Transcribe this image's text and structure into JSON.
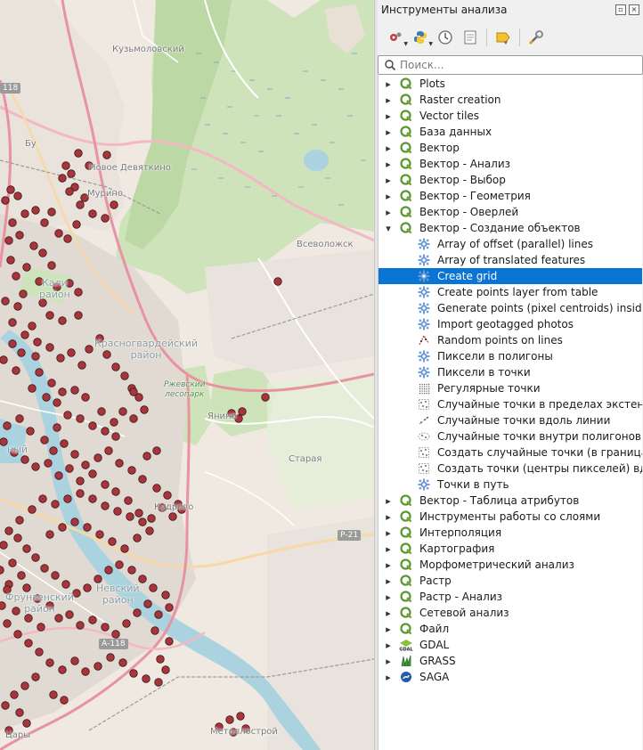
{
  "panel": {
    "title": "Инструменты анализа",
    "search_placeholder": "Поиск...",
    "toolbar": [
      "models-icon",
      "python-icon",
      "history-icon",
      "results-icon",
      "edit-features-icon",
      "options-icon"
    ]
  },
  "map": {
    "labels": {
      "kuzmolovsky": "Кузьмоловский",
      "novoe_devyatkino": "Новое Девяткино",
      "murino": "Мурино",
      "vsevolozhsk": "Всеволожск",
      "kalininsky_1": "Кали",
      "kalininsky_2": "район",
      "krasnogvardeisky_1": "Красногвардейский",
      "krasnogvardeisky_2": "район",
      "rzhevsky_1": "Ржевский",
      "rzhevsky_2": "лесопарк",
      "yanino": "Янино",
      "staraya": "Старая",
      "kudrovo": "Кудрово",
      "nevsky_1": "Невский",
      "nevsky_2": "район",
      "frunzensky_1": "Фрунзенский",
      "frunzensky_2": "район",
      "metallostroy": "Металлострой",
      "a118_top": "118",
      "a118_bottom": "А-118",
      "r21": "Р-21",
      "bu": "Бу",
      "ny": "ный",
      "tsary": "Цары"
    }
  },
  "tree": [
    {
      "label": "Plots",
      "level": 0,
      "icon": "qgis-icon",
      "expanded": false
    },
    {
      "label": "Raster creation",
      "level": 0,
      "icon": "qgis-icon",
      "expanded": false
    },
    {
      "label": "Vector tiles",
      "level": 0,
      "icon": "qgis-icon",
      "expanded": false
    },
    {
      "label": "База данных",
      "level": 0,
      "icon": "qgis-icon",
      "expanded": false
    },
    {
      "label": "Вектор",
      "level": 0,
      "icon": "qgis-icon",
      "expanded": false
    },
    {
      "label": "Вектор - Анализ",
      "level": 0,
      "icon": "qgis-icon",
      "expanded": false
    },
    {
      "label": "Вектор - Выбор",
      "level": 0,
      "icon": "qgis-icon",
      "expanded": false
    },
    {
      "label": "Вектор - Геометрия",
      "level": 0,
      "icon": "qgis-icon",
      "expanded": false
    },
    {
      "label": "Вектор - Оверлей",
      "level": 0,
      "icon": "qgis-icon",
      "expanded": false
    },
    {
      "label": "Вектор - Создание объектов",
      "level": 0,
      "icon": "qgis-icon",
      "expanded": true
    },
    {
      "label": "Array of offset (parallel) lines",
      "level": 1,
      "icon": "gear-icon"
    },
    {
      "label": "Array of translated features",
      "level": 1,
      "icon": "gear-icon"
    },
    {
      "label": "Create grid",
      "level": 1,
      "icon": "gear-icon",
      "selected": true
    },
    {
      "label": "Create points layer from table",
      "level": 1,
      "icon": "gear-icon"
    },
    {
      "label": "Generate points (pixel centroids) inside p...",
      "level": 1,
      "icon": "gear-icon"
    },
    {
      "label": "Import geotagged photos",
      "level": 1,
      "icon": "gear-icon"
    },
    {
      "label": "Random points on lines",
      "level": 1,
      "icon": "random-points-lines-icon"
    },
    {
      "label": "Пиксели в полигоны",
      "level": 1,
      "icon": "gear-icon"
    },
    {
      "label": "Пиксели в точки",
      "level": 1,
      "icon": "gear-icon"
    },
    {
      "label": "Регулярные точки",
      "level": 1,
      "icon": "regular-points-icon"
    },
    {
      "label": "Случайные точки в пределах экстента",
      "level": 1,
      "icon": "random-points-extent-icon"
    },
    {
      "label": "Случайные точки вдоль линии",
      "level": 1,
      "icon": "random-points-line-icon"
    },
    {
      "label": "Случайные точки внутри полигонов",
      "level": 1,
      "icon": "random-points-polygon-icon"
    },
    {
      "label": "Создать случайные точки (в границах с...",
      "level": 1,
      "icon": "random-points-extent-icon"
    },
    {
      "label": "Создать точки (центры пикселей) вдол...",
      "level": 1,
      "icon": "random-points-extent-icon"
    },
    {
      "label": "Точки в путь",
      "level": 1,
      "icon": "gear-icon"
    },
    {
      "label": "Вектор - Таблица атрибутов",
      "level": 0,
      "icon": "qgis-icon",
      "expanded": false
    },
    {
      "label": "Инструменты работы со слоями",
      "level": 0,
      "icon": "qgis-icon",
      "expanded": false
    },
    {
      "label": "Интерполяция",
      "level": 0,
      "icon": "qgis-icon",
      "expanded": false
    },
    {
      "label": "Картография",
      "level": 0,
      "icon": "qgis-icon",
      "expanded": false
    },
    {
      "label": "Морфометрический анализ",
      "level": 0,
      "icon": "qgis-icon",
      "expanded": false
    },
    {
      "label": "Растр",
      "level": 0,
      "icon": "qgis-icon",
      "expanded": false
    },
    {
      "label": "Растр - Анализ",
      "level": 0,
      "icon": "qgis-icon",
      "expanded": false
    },
    {
      "label": "Сетевой анализ",
      "level": 0,
      "icon": "qgis-icon",
      "expanded": false
    },
    {
      "label": "Файл",
      "level": 0,
      "icon": "qgis-icon",
      "expanded": false
    },
    {
      "label": "GDAL",
      "level": 0,
      "icon": "gdal-icon",
      "expanded": false
    },
    {
      "label": "GRASS",
      "level": 0,
      "icon": "grass-icon",
      "expanded": false
    },
    {
      "label": "SAGA",
      "level": 0,
      "icon": "saga-icon",
      "expanded": false
    }
  ],
  "colors": {
    "selection": "#0a74d4",
    "point_fill": "#a8343c",
    "qgis_green": "#589632"
  }
}
